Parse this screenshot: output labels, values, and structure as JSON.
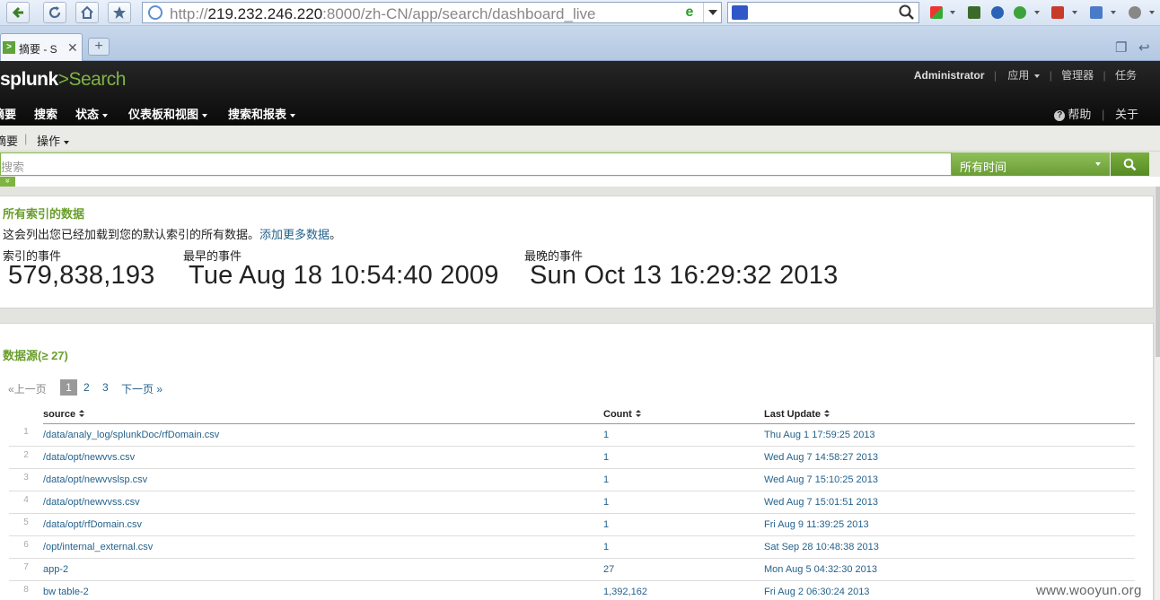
{
  "browser": {
    "url_prefix": "http://",
    "url_host": "219.232.246.220",
    "url_rest": ":8000/zh-CN/app/search/dashboard_live",
    "tab_title": "摘要 - S",
    "tab_favicon": ">",
    "tab_close": "✕",
    "new_tab": "+",
    "ie_mark": "e"
  },
  "header": {
    "logo_main": "splunk",
    "logo_gt": ">",
    "logo_app": "Search",
    "user": "Administrator",
    "apps_label": "应用",
    "manager_label": "管理器",
    "jobs_label": "任务"
  },
  "nav": {
    "items": [
      "摘要",
      "搜索",
      "状态",
      "仪表板和视图",
      "搜索和报表"
    ],
    "help_label": "帮助",
    "about_label": "关于"
  },
  "appbar": {
    "summary": "摘要",
    "actions": "操作",
    "sep": "|"
  },
  "search": {
    "placeholder": "搜索",
    "time_range": "所有时间",
    "collapse_symbol": "»"
  },
  "summary_panel": {
    "title": "所有索引的数据",
    "desc_text": "这会列出您已经加载到您的默认索引的所有数据。",
    "desc_link": "添加更多数据",
    "desc_end": "。",
    "indexed_label": "索引的事件",
    "indexed_value": "579,838,193",
    "earliest_label": "最早的事件",
    "earliest_value": "Tue Aug 18 10:54:40 2009",
    "latest_label": "最晚的事件",
    "latest_value": "Sun Oct 13 16:29:32 2013"
  },
  "sources_panel": {
    "title": "数据源(≥ 27)",
    "pager": {
      "prev": "«上一页",
      "pages": [
        "1",
        "2",
        "3"
      ],
      "next": "下一页 »"
    },
    "columns": [
      "source",
      "Count",
      "Last Update"
    ],
    "rows": [
      {
        "n": "1",
        "source": "/data/analy_log/splunkDoc/rfDomain.csv",
        "count": "1",
        "updated": "Thu Aug 1 17:59:25 2013"
      },
      {
        "n": "2",
        "source": "/data/opt/newvvs.csv",
        "count": "1",
        "updated": "Wed Aug 7 14:58:27 2013"
      },
      {
        "n": "3",
        "source": "/data/opt/newvvslsp.csv",
        "count": "1",
        "updated": "Wed Aug 7 15:10:25 2013"
      },
      {
        "n": "4",
        "source": "/data/opt/newvvss.csv",
        "count": "1",
        "updated": "Wed Aug 7 15:01:51 2013"
      },
      {
        "n": "5",
        "source": "/data/opt/rfDomain.csv",
        "count": "1",
        "updated": "Fri Aug 9 11:39:25 2013"
      },
      {
        "n": "6",
        "source": "/opt/internal_external.csv",
        "count": "1",
        "updated": "Sat Sep 28 10:48:38 2013"
      },
      {
        "n": "7",
        "source": "app-2",
        "count": "27",
        "updated": "Mon Aug 5 04:32:30 2013"
      },
      {
        "n": "8",
        "source": "bw table-2",
        "count": "1,392,162",
        "updated": "Fri Aug 2 06:30:24 2013"
      }
    ]
  },
  "watermark": "www.wooyun.org",
  "colors": {
    "accent_green": "#7fb442",
    "link_blue": "#25628c",
    "header_black": "#111111"
  }
}
